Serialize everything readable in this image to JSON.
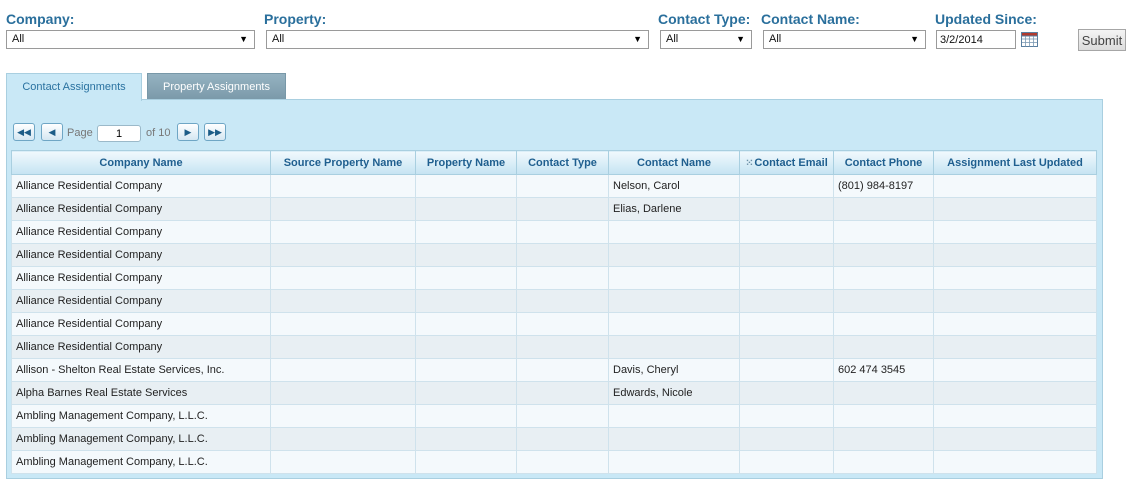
{
  "filters": {
    "company": {
      "label": "Company:",
      "value": "All"
    },
    "property": {
      "label": "Property:",
      "value": "All"
    },
    "contact_type": {
      "label": "Contact Type:",
      "value": "All"
    },
    "contact_name": {
      "label": "Contact Name:",
      "value": "All"
    },
    "updated_since": {
      "label": "Updated Since:",
      "value": "3/2/2014"
    },
    "submit_label": "Submit"
  },
  "tabs": [
    {
      "label": "Contact Assignments",
      "active": true
    },
    {
      "label": "Property Assignments",
      "active": false
    }
  ],
  "pager": {
    "first_icon": "first-page-icon",
    "prev_icon": "prev-page-icon",
    "page_label": "Page",
    "current_page": "1",
    "of_label": "of 10",
    "next_icon": "next-page-icon",
    "last_icon": "last-page-icon"
  },
  "table": {
    "columns": [
      "Company Name",
      "Source Property Name",
      "Property Name",
      "Contact Type",
      "Contact Name",
      "Contact Email",
      "Contact Phone",
      "Assignment Last Updated"
    ],
    "rows": [
      [
        "Alliance Residential Company",
        "",
        "",
        "",
        "Nelson, Carol",
        "",
        "(801) 984-8197",
        ""
      ],
      [
        "Alliance Residential Company",
        "",
        "",
        "",
        "Elias, Darlene",
        "",
        "",
        ""
      ],
      [
        "Alliance Residential Company",
        "",
        "",
        "",
        "",
        "",
        "",
        ""
      ],
      [
        "Alliance Residential Company",
        "",
        "",
        "",
        "",
        "",
        "",
        ""
      ],
      [
        "Alliance Residential Company",
        "",
        "",
        "",
        "",
        "",
        "",
        ""
      ],
      [
        "Alliance Residential Company",
        "",
        "",
        "",
        "",
        "",
        "",
        ""
      ],
      [
        "Alliance Residential Company",
        "",
        "",
        "",
        "",
        "",
        "",
        ""
      ],
      [
        "Alliance Residential Company",
        "",
        "",
        "",
        "",
        "",
        "",
        ""
      ],
      [
        "Allison - Shelton Real Estate Services, Inc.",
        "",
        "",
        "",
        "Davis, Cheryl",
        "",
        "602 474 3545",
        ""
      ],
      [
        "Alpha Barnes Real Estate Services",
        "",
        "",
        "",
        "Edwards, Nicole",
        "",
        "",
        ""
      ],
      [
        "Ambling Management Company, L.L.C.",
        "",
        "",
        "",
        "",
        "",
        "",
        ""
      ],
      [
        "Ambling Management Company, L.L.C.",
        "",
        "",
        "",
        "",
        "",
        "",
        ""
      ],
      [
        "Ambling Management Company, L.L.C.",
        "",
        "",
        "",
        "",
        "",
        "",
        ""
      ]
    ]
  }
}
